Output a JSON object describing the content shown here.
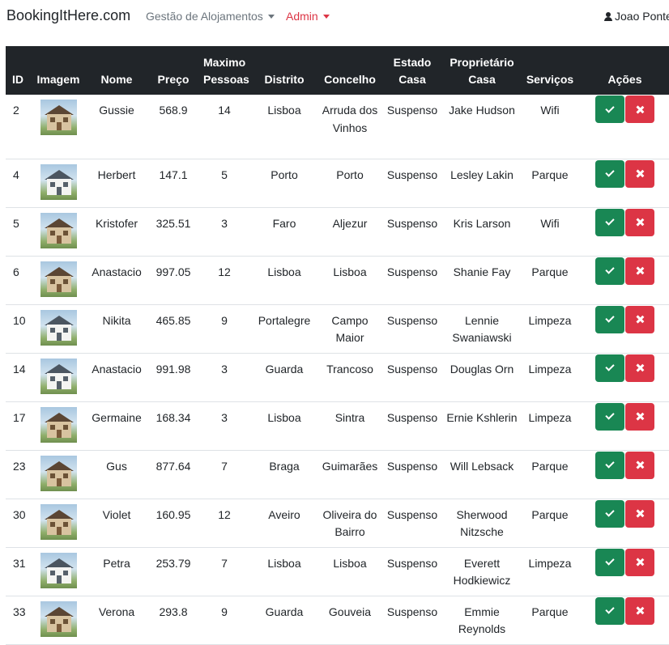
{
  "navbar": {
    "brand": "BookingItHere.com",
    "menu_alojamentos": "Gestão de Alojamentos",
    "menu_admin": "Admin",
    "user_name": "Joao Ponte"
  },
  "table": {
    "headers": {
      "id": "ID",
      "imagem": "Imagem",
      "nome": "Nome",
      "preco": "Preço",
      "maximo_pessoas": "Maximo Pessoas",
      "distrito": "Distrito",
      "concelho": "Concelho",
      "estado_casa": "Estado Casa",
      "proprietario_casa": "Proprietário Casa",
      "servicos": "Serviços",
      "acoes": "Ações"
    },
    "rows": [
      {
        "id": "2",
        "image": "house-wood",
        "nome": "Gussie",
        "preco": "568.9",
        "max": "14",
        "distrito": "Lisboa",
        "concelho": "Arruda dos Vinhos",
        "estado": "Suspenso",
        "proprietario": "Jake Hudson",
        "servico": "Wifi"
      },
      {
        "id": "4",
        "image": "house-white",
        "nome": "Herbert",
        "preco": "147.1",
        "max": "5",
        "distrito": "Porto",
        "concelho": "Porto",
        "estado": "Suspenso",
        "proprietario": "Lesley Lakin",
        "servico": "Parque"
      },
      {
        "id": "5",
        "image": "house-wood",
        "nome": "Kristofer",
        "preco": "325.51",
        "max": "3",
        "distrito": "Faro",
        "concelho": "Aljezur",
        "estado": "Suspenso",
        "proprietario": "Kris Larson",
        "servico": "Wifi"
      },
      {
        "id": "6",
        "image": "house-wood",
        "nome": "Anastacio",
        "preco": "997.05",
        "max": "12",
        "distrito": "Lisboa",
        "concelho": "Lisboa",
        "estado": "Suspenso",
        "proprietario": "Shanie Fay",
        "servico": "Parque"
      },
      {
        "id": "10",
        "image": "house-white",
        "nome": "Nikita",
        "preco": "465.85",
        "max": "9",
        "distrito": "Portalegre",
        "concelho": "Campo Maior",
        "estado": "Suspenso",
        "proprietario": "Lennie Swaniawski",
        "servico": "Limpeza"
      },
      {
        "id": "14",
        "image": "house-white",
        "nome": "Anastacio",
        "preco": "991.98",
        "max": "3",
        "distrito": "Guarda",
        "concelho": "Trancoso",
        "estado": "Suspenso",
        "proprietario": "Douglas Orn",
        "servico": "Limpeza"
      },
      {
        "id": "17",
        "image": "house-wood",
        "nome": "Germaine",
        "preco": "168.34",
        "max": "3",
        "distrito": "Lisboa",
        "concelho": "Sintra",
        "estado": "Suspenso",
        "proprietario": "Ernie Kshlerin",
        "servico": "Limpeza"
      },
      {
        "id": "23",
        "image": "house-wood",
        "nome": "Gus",
        "preco": "877.64",
        "max": "7",
        "distrito": "Braga",
        "concelho": "Guimarães",
        "estado": "Suspenso",
        "proprietario": "Will Lebsack",
        "servico": "Parque"
      },
      {
        "id": "30",
        "image": "house-wood",
        "nome": "Violet",
        "preco": "160.95",
        "max": "12",
        "distrito": "Aveiro",
        "concelho": "Oliveira do Bairro",
        "estado": "Suspenso",
        "proprietario": "Sherwood Nitzsche",
        "servico": "Parque"
      },
      {
        "id": "31",
        "image": "house-white",
        "nome": "Petra",
        "preco": "253.79",
        "max": "7",
        "distrito": "Lisboa",
        "concelho": "Lisboa",
        "estado": "Suspenso",
        "proprietario": "Everett Hodkiewicz",
        "servico": "Limpeza"
      },
      {
        "id": "33",
        "image": "house-wood",
        "nome": "Verona",
        "preco": "293.8",
        "max": "9",
        "distrito": "Guarda",
        "concelho": "Gouveia",
        "estado": "Suspenso",
        "proprietario": "Emmie Reynolds",
        "servico": "Parque"
      }
    ]
  },
  "colors": {
    "header_bg": "#212529",
    "approve": "#198754",
    "reject": "#dc3545",
    "admin_link": "#dc3545"
  }
}
